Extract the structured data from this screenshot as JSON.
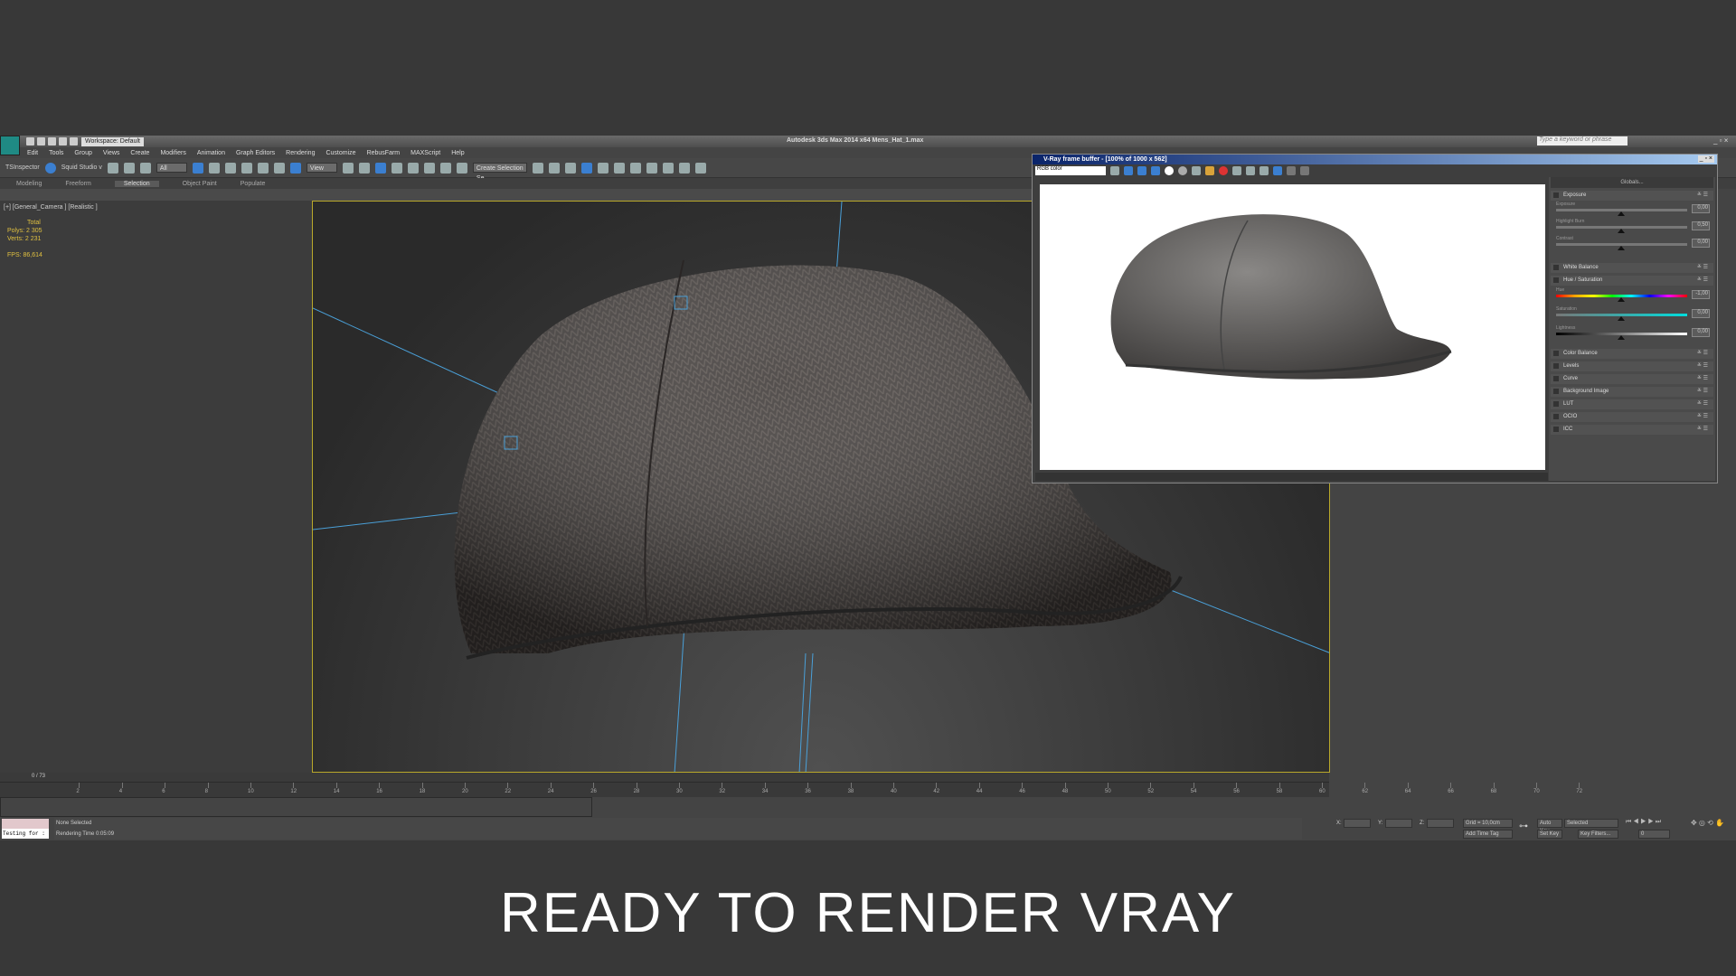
{
  "app": {
    "title": "Autodesk 3ds Max  2014 x64    Mens_Hat_1.max",
    "workspace": "Workspace: Default",
    "search_placeholder": "Type a keyword or phrase"
  },
  "menu": [
    "Edit",
    "Tools",
    "Group",
    "Views",
    "Create",
    "Modifiers",
    "Animation",
    "Graph Editors",
    "Rendering",
    "Customize",
    "RebusFarm",
    "MAXScript",
    "Help"
  ],
  "toolbar": {
    "ts": "TSInspector",
    "squid": "Squid Studio v",
    "filter": "All",
    "refcoord": "View",
    "selset": "Create Selection Se"
  },
  "ribbon_tabs": [
    "Modeling",
    "Freeform",
    "Selection",
    "Object Paint",
    "Populate"
  ],
  "viewport": {
    "label": "[+] [General_Camera ] [Realistic ]",
    "stats_header": "Total",
    "polys_label": "Polys:",
    "polys": "2 305",
    "verts_label": "Verts:",
    "verts": "2 231",
    "fps_label": "FPS:",
    "fps": "86,614"
  },
  "vfb": {
    "title": "V-Ray frame buffer - [100% of 1000 x 562]",
    "channel": "RGB color",
    "globals": "Globals...",
    "sections": [
      {
        "label": "Exposure",
        "sliders": [
          {
            "label": "Exposure",
            "value": "0,00"
          },
          {
            "label": "Highlight Burn",
            "value": "0,50"
          },
          {
            "label": "Contrast",
            "value": "0,00"
          }
        ]
      },
      {
        "label": "White Balance"
      },
      {
        "label": "Hue / Saturation",
        "sliders": [
          {
            "label": "Hue",
            "value": "-1,00"
          },
          {
            "label": "Saturation",
            "value": "0,00"
          },
          {
            "label": "Lightness",
            "value": "0,00"
          }
        ]
      },
      {
        "label": "Color Balance"
      },
      {
        "label": "Levels"
      },
      {
        "label": "Curve"
      },
      {
        "label": "Background Image"
      },
      {
        "label": "LUT"
      },
      {
        "label": "OCIO"
      },
      {
        "label": "ICC"
      }
    ]
  },
  "timeline": {
    "frame": "0 / 73",
    "ticks": [
      "2",
      "4",
      "6",
      "8",
      "10",
      "12",
      "14",
      "16",
      "18",
      "20",
      "22",
      "24",
      "26",
      "28",
      "30",
      "32",
      "34",
      "36",
      "38",
      "40",
      "42",
      "44",
      "46",
      "48",
      "50",
      "52",
      "54",
      "56",
      "58",
      "60",
      "62",
      "64",
      "66",
      "68",
      "70",
      "72"
    ]
  },
  "status": {
    "selection": "None Selected",
    "render_time": "Rendering Time  0:05:09",
    "script": "Testing for :",
    "x": "X:",
    "y": "Y:",
    "z": "Z:",
    "grid": "Grid = 10,0cm",
    "add_time_tag": "Add Time Tag",
    "auto_key": "Auto Key",
    "set_key": "Set Key",
    "key_mode": "Selected",
    "key_filters": "Key Filters...",
    "frame_field": "0"
  },
  "caption": "READY TO RENDER VRAY"
}
